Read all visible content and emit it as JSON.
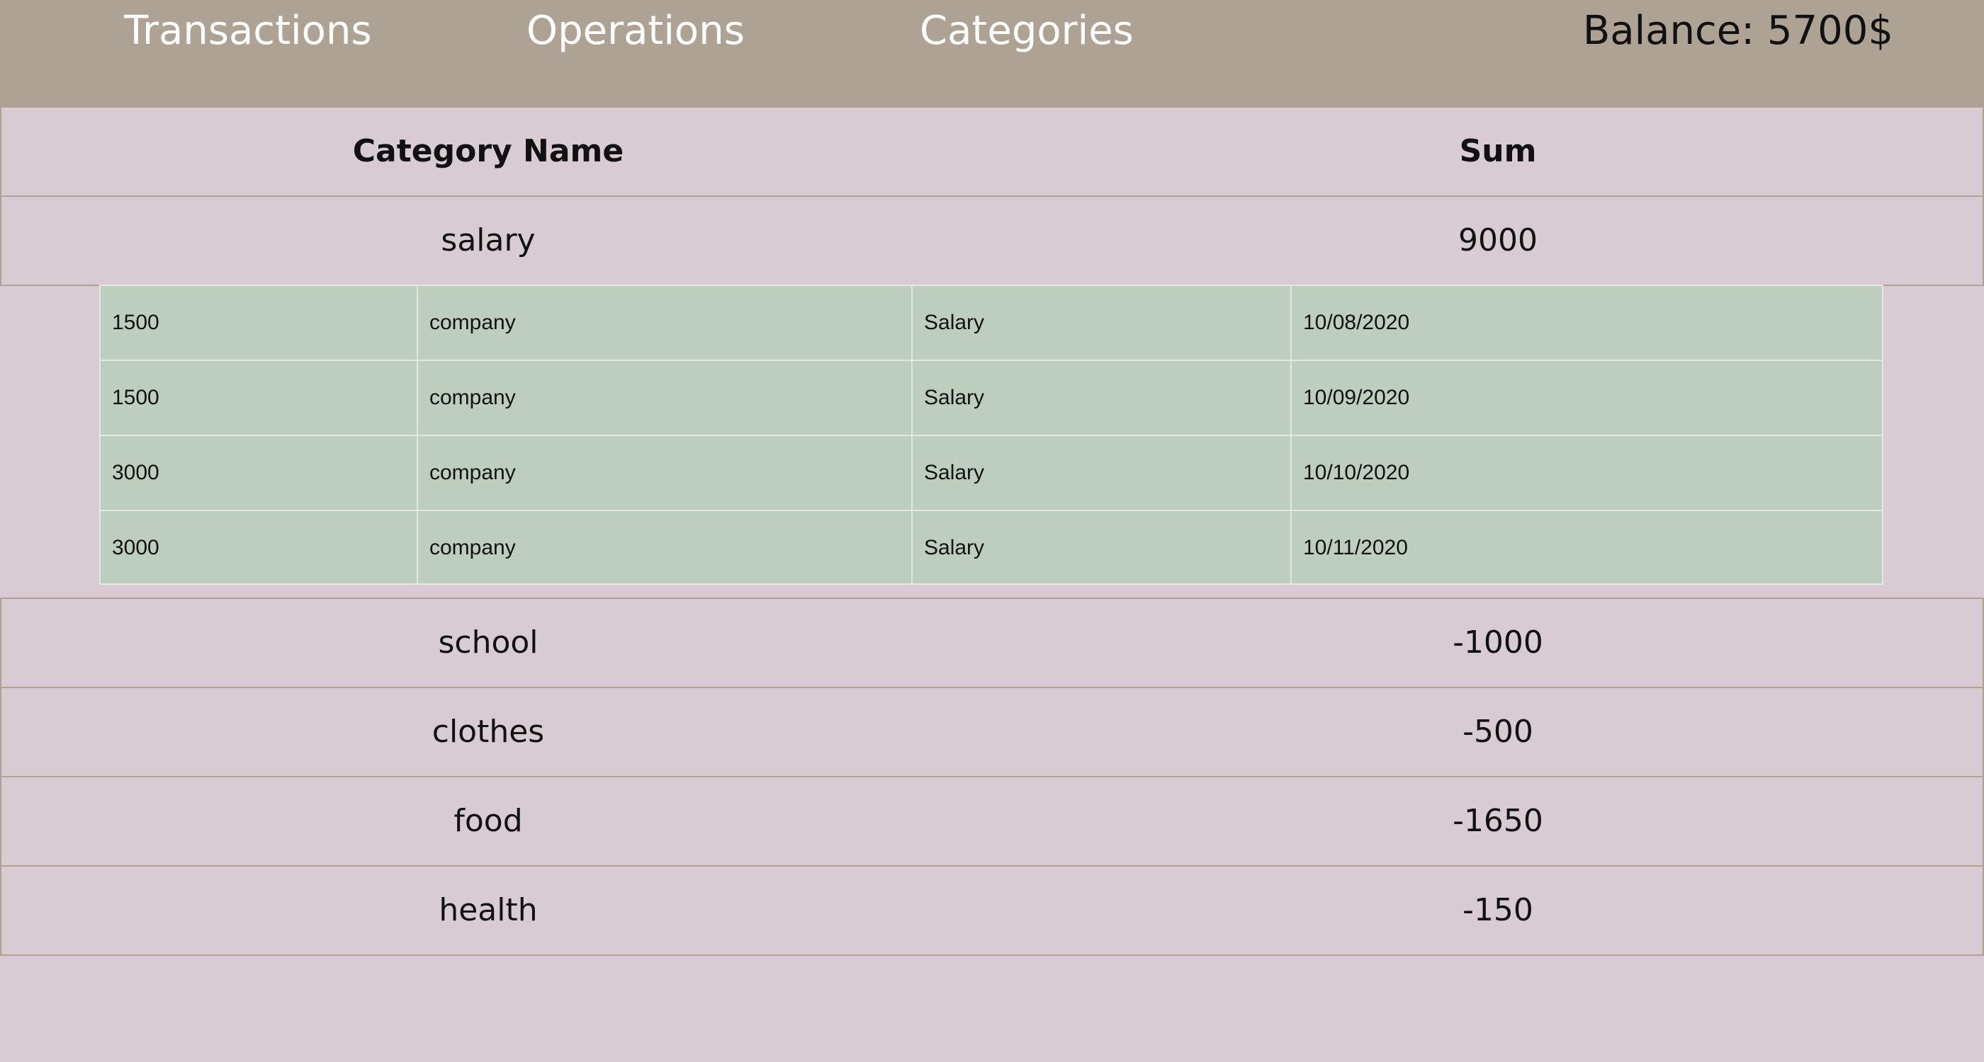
{
  "nav": {
    "items": [
      {
        "label": "Transactions"
      },
      {
        "label": "Operations"
      },
      {
        "label": "Categories"
      }
    ],
    "balance": "Balance: 5700$"
  },
  "table": {
    "headers": {
      "name": "Category Name",
      "sum": "Sum"
    },
    "rows": [
      {
        "name": "salary",
        "sum": "9000"
      },
      {
        "name": "school",
        "sum": "-1000"
      },
      {
        "name": "clothes",
        "sum": "-500"
      },
      {
        "name": "food",
        "sum": "-1650"
      },
      {
        "name": "health",
        "sum": "-150"
      }
    ]
  },
  "expanded": {
    "rows": [
      {
        "amount": "1500",
        "source": "company",
        "category": "Salary",
        "date": "10/08/2020"
      },
      {
        "amount": "1500",
        "source": "company",
        "category": "Salary",
        "date": "10/09/2020"
      },
      {
        "amount": "3000",
        "source": "company",
        "category": "Salary",
        "date": "10/10/2020"
      },
      {
        "amount": "3000",
        "source": "company",
        "category": "Salary",
        "date": "10/11/2020"
      }
    ]
  }
}
